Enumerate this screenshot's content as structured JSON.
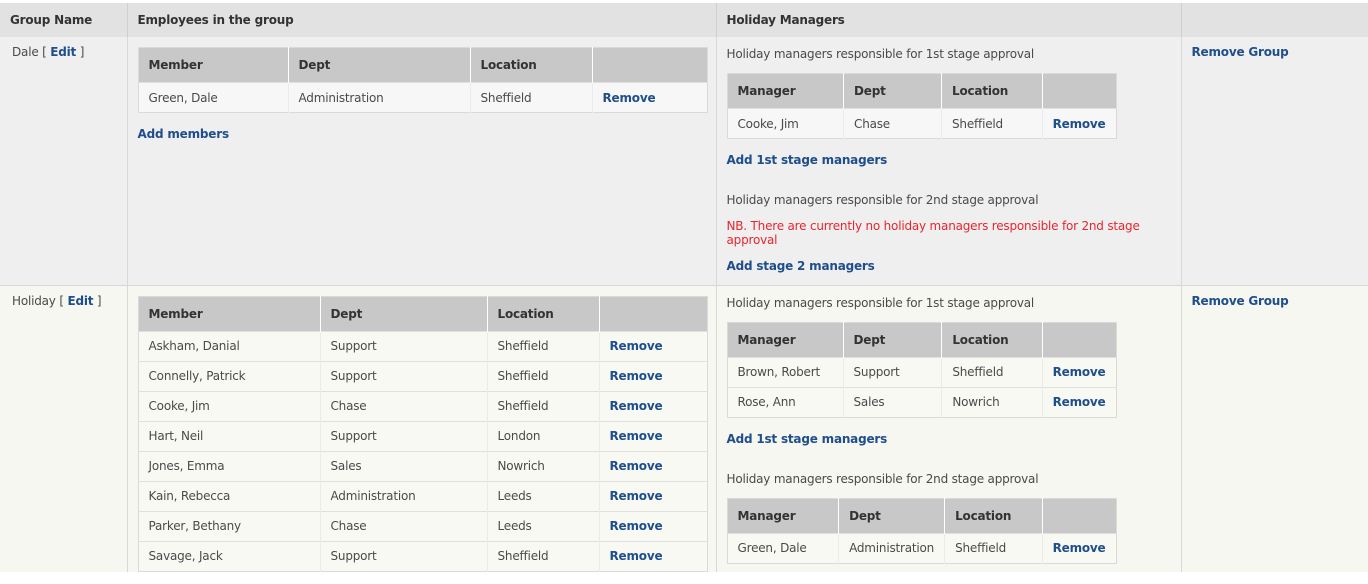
{
  "header": {
    "group_name": "Group Name",
    "employees": "Employees in the group",
    "holiday_managers": "Holiday Managers"
  },
  "labels": {
    "edit": "Edit",
    "remove": "Remove",
    "remove_group": "Remove Group",
    "add_members": "Add members",
    "add_1st": "Add 1st stage managers",
    "add_2nd": "Add stage 2 managers",
    "stage1_note": "Holiday managers responsible for 1st stage approval",
    "stage2_note": "Holiday managers responsible for 2nd stage approval",
    "no_stage2_warning": "NB. There are currently no holiday managers responsible for 2nd stage approval",
    "col_member": "Member",
    "col_manager": "Manager",
    "col_dept": "Dept",
    "col_location": "Location"
  },
  "groups": [
    {
      "name": "Dale",
      "members": [
        {
          "name": "Green, Dale",
          "dept": "Administration",
          "location": "Sheffield"
        }
      ],
      "stage1": [
        {
          "name": "Cooke, Jim",
          "dept": "Chase",
          "location": "Sheffield"
        }
      ],
      "stage2": []
    },
    {
      "name": "Holiday",
      "members": [
        {
          "name": "Askham, Danial",
          "dept": "Support",
          "location": "Sheffield"
        },
        {
          "name": "Connelly, Patrick",
          "dept": "Support",
          "location": "Sheffield"
        },
        {
          "name": "Cooke, Jim",
          "dept": "Chase",
          "location": "Sheffield"
        },
        {
          "name": "Hart, Neil",
          "dept": "Support",
          "location": "London"
        },
        {
          "name": "Jones, Emma",
          "dept": "Sales",
          "location": "Nowrich"
        },
        {
          "name": "Kain, Rebecca",
          "dept": "Administration",
          "location": "Leeds"
        },
        {
          "name": "Parker, Bethany",
          "dept": "Chase",
          "location": "Leeds"
        },
        {
          "name": "Savage, Jack",
          "dept": "Support",
          "location": "Sheffield"
        }
      ],
      "stage1": [
        {
          "name": "Brown, Robert",
          "dept": "Support",
          "location": "Sheffield"
        },
        {
          "name": "Rose, Ann",
          "dept": "Sales",
          "location": "Nowrich"
        }
      ],
      "stage2": [
        {
          "name": "Green, Dale",
          "dept": "Administration",
          "location": "Sheffield"
        }
      ]
    }
  ]
}
